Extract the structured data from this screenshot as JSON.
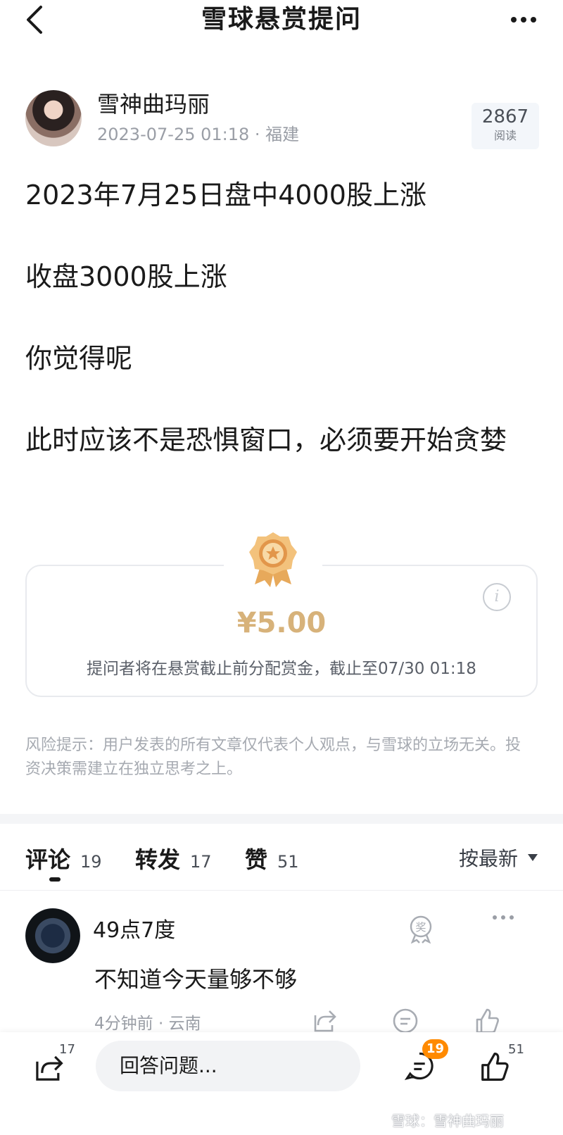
{
  "header": {
    "title": "雪球悬赏提问"
  },
  "author": {
    "name": "雪神曲玛丽",
    "meta": "2023-07-25 01:18 · 福建",
    "read_count": "2867",
    "read_label": "阅读"
  },
  "post": {
    "paragraphs": [
      "2023年7月25日盘中4000股上涨",
      "收盘3000股上涨",
      "你觉得呢",
      "此时应该不是恐惧窗口，必须要开始贪婪"
    ]
  },
  "reward": {
    "amount": "¥5.00",
    "description": "提问者将在悬赏截止前分配赏金，截止至07/30 01:18",
    "info_icon": "info-icon"
  },
  "risk_note": "风险提示：用户发表的所有文章仅代表个人观点，与雪球的立场无关。投资决策需建立在独立思考之上。",
  "tabs": [
    {
      "label": "评论",
      "count": "19"
    },
    {
      "label": "转发",
      "count": "17"
    },
    {
      "label": "赞",
      "count": "51"
    }
  ],
  "sort": {
    "label": "按最新"
  },
  "comment": {
    "name": "49点7度",
    "text": "不知道今天量够不够",
    "meta": "4分钟前 · 云南"
  },
  "bottom_bar": {
    "share_count": "17",
    "answer_placeholder": "回答问题...",
    "comment_badge": "19",
    "like_count": "51",
    "watermark": "雪球：雪神曲玛丽"
  },
  "colors": {
    "reward_gold": "#d7b27a",
    "badge_orange": "#ff8a00",
    "meta_gray": "#9a9ea6"
  }
}
